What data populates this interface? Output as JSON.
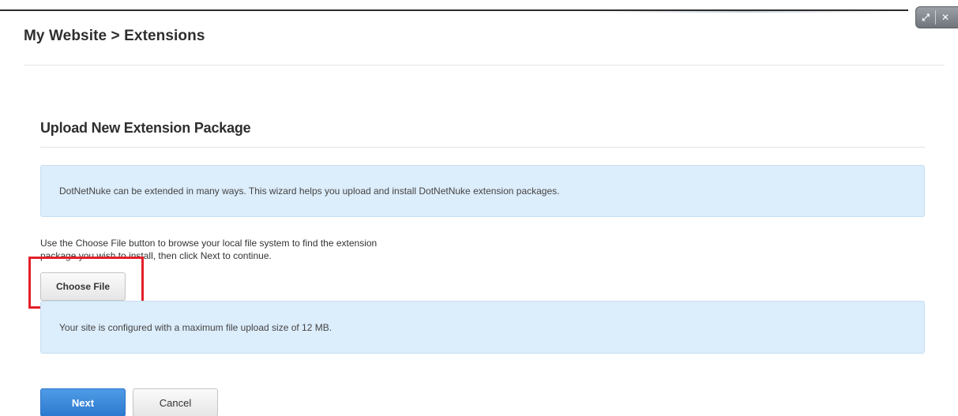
{
  "header": {
    "breadcrumb": "My Website > Extensions"
  },
  "window_controls": {
    "expand_icon": "expand-icon",
    "close_icon": "close-icon"
  },
  "wizard": {
    "title": "Upload New Extension Package",
    "intro_text": "DotNetNuke can be extended in many ways. This wizard helps you upload and install DotNetNuke extension packages.",
    "instructions_line1": "Use the Choose File button to browse your local file system to find the extension",
    "instructions_line2": "package you wish to install, then click Next to continue.",
    "choose_file_label": "Choose File",
    "upload_limit_text": "Your site is configured with a maximum file upload size of 12 MB."
  },
  "actions": {
    "next_label": "Next",
    "cancel_label": "Cancel"
  },
  "colors": {
    "info_background": "#dcedfb",
    "primary_button": "#2c7ad0",
    "highlight": "#e3202a"
  }
}
